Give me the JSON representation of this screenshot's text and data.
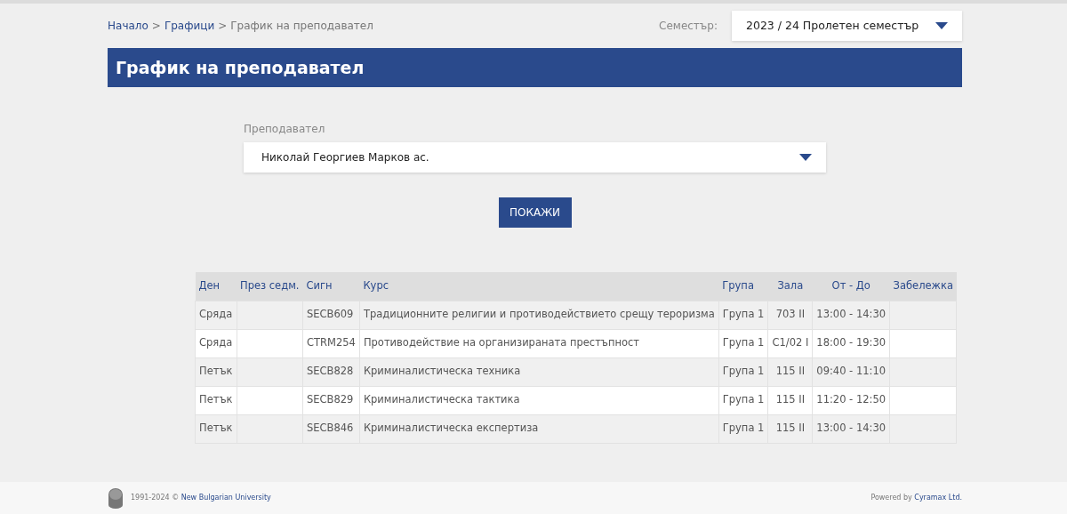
{
  "breadcrumb": [
    {
      "label": "Начало",
      "kind": "link"
    },
    {
      "label": ">",
      "kind": "separator"
    },
    {
      "label": "Графици",
      "kind": "link"
    },
    {
      "label": ">",
      "kind": "separator"
    },
    {
      "label": "График на преподавател",
      "kind": "current"
    }
  ],
  "semester": {
    "label": "Семестър:",
    "value": "2023 / 24 Пролетен семестър"
  },
  "page_title": "График на преподавател",
  "lecturer": {
    "label": "Преподавател",
    "value": "Николай Георгиев Марков ас."
  },
  "show_button": "ПОКАЖИ",
  "table": {
    "columns": [
      "Ден",
      "През седм.",
      "Сигн",
      "Курс",
      "Група",
      "Зала",
      "От - До",
      "Забележка"
    ],
    "rows": [
      [
        "Сряда",
        "",
        "SECB609",
        "Традиционните религии и противодействието срещу тероризма",
        "Група 1",
        "703 II",
        "13:00 - 14:30",
        ""
      ],
      [
        "Сряда",
        "",
        "CTRM254",
        "Противодействие на организираната престъпност",
        "Група 1",
        "C1/02 I",
        "18:00 - 19:30",
        ""
      ],
      [
        "Петък",
        "",
        "SECB828",
        "Криминалистическа техника",
        "Група 1",
        "115 II",
        "09:40 - 11:10",
        ""
      ],
      [
        "Петък",
        "",
        "SECB829",
        "Криминалистическа тактика",
        "Група 1",
        "115 II",
        "11:20 - 12:50",
        ""
      ],
      [
        "Петък",
        "",
        "SECB846",
        "Криминалистическа експертиза",
        "Група 1",
        "115 II",
        "13:00 - 14:30",
        ""
      ]
    ]
  },
  "footer": {
    "copyright": "1991-2024 ©",
    "university": "New Bulgarian University",
    "powered_by": "Powered by",
    "vendor": "Cyramax Ltd."
  }
}
